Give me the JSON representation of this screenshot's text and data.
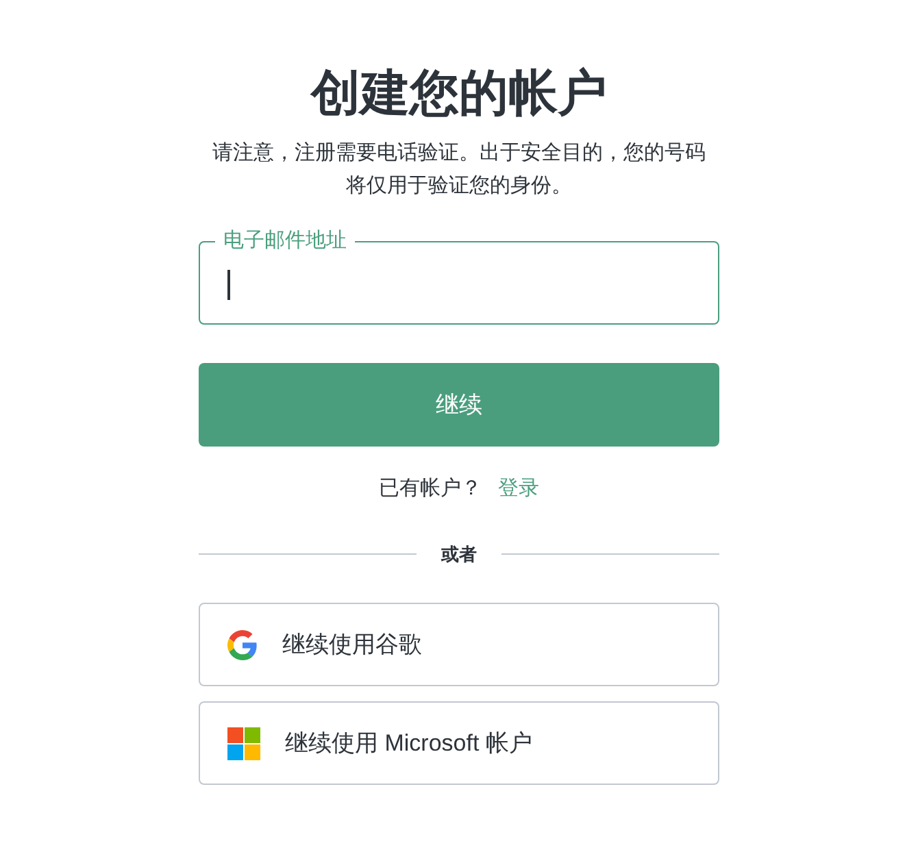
{
  "title": "创建您的帐户",
  "notice": "请注意，注册需要电话验证。出于安全目的，您的号码将仅用于验证您的身份。",
  "email_field": {
    "label": "电子邮件地址",
    "focused": true
  },
  "continue_button": "继续",
  "login_prompt": {
    "text": "已有帐户？",
    "link": "登录"
  },
  "divider": "或者",
  "social_buttons": [
    {
      "kind": "google",
      "label": "继续使用谷歌"
    },
    {
      "kind": "microsoft",
      "label": "继续使用 Microsoft 帐户"
    }
  ]
}
